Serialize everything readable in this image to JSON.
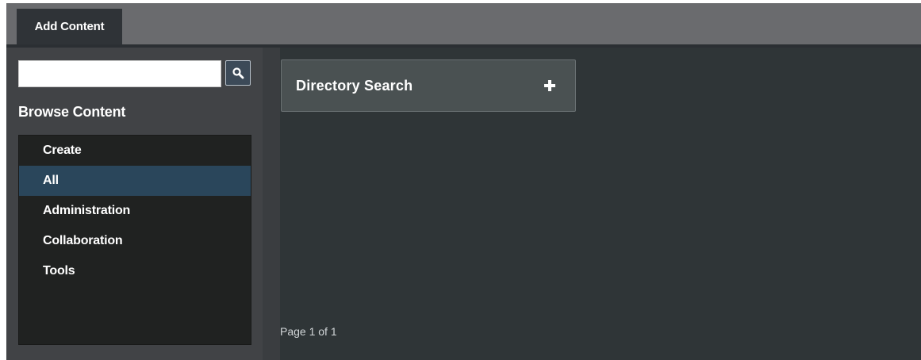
{
  "tabs": [
    {
      "label": "Add Content",
      "active": true
    }
  ],
  "sidebar": {
    "search": {
      "value": "",
      "placeholder": ""
    },
    "heading": "Browse Content",
    "categories": [
      {
        "label": "Create",
        "selected": false
      },
      {
        "label": "All",
        "selected": true
      },
      {
        "label": "Administration",
        "selected": false
      },
      {
        "label": "Collaboration",
        "selected": false
      },
      {
        "label": "Tools",
        "selected": false
      }
    ]
  },
  "main": {
    "cards": [
      {
        "title": "Directory Search",
        "icon": "plus-icon"
      }
    ],
    "pager": "Page 1 of 1"
  },
  "colors": {
    "tab_bar": "#6a6b6e",
    "active_tab": "#2f3337",
    "sidebar_bg": "#414346",
    "list_bg": "#202221",
    "selected_item": "#2a465b",
    "main_bg": "#2f3537",
    "card_bg": "#4a5152",
    "search_button": "#3c4a58"
  },
  "icons": [
    "search-icon",
    "plus-icon"
  ]
}
